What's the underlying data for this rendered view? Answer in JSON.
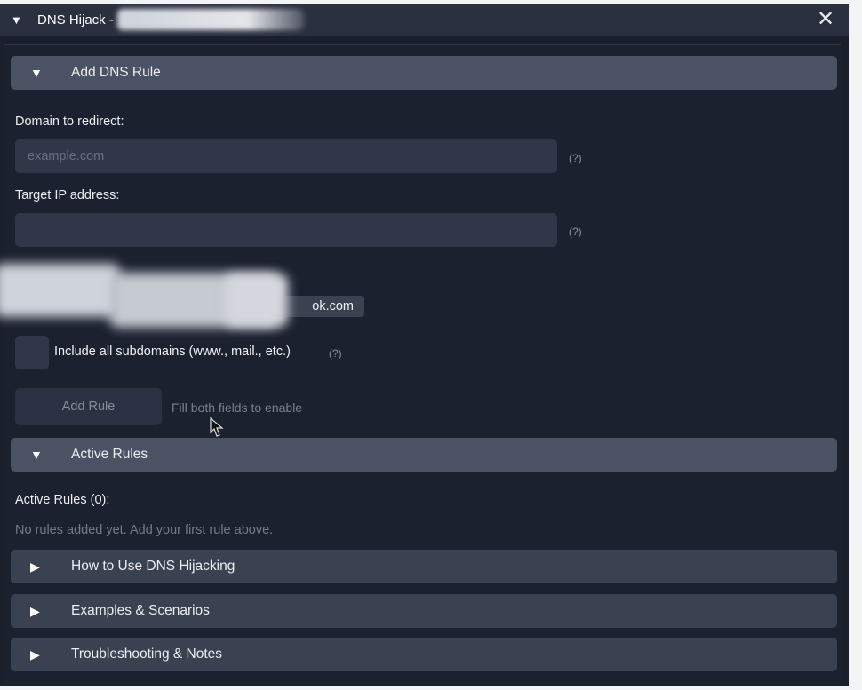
{
  "window": {
    "title": "DNS Hijack -",
    "title_arrow": "▼",
    "close_glyph": "✕"
  },
  "sections": {
    "add_rule": {
      "arrow": "▼",
      "label": "Add DNS Rule"
    },
    "active_rules": {
      "arrow": "▼",
      "label": "Active Rules"
    },
    "how_to": {
      "arrow": "▶",
      "label": "How to Use DNS Hijacking"
    },
    "examples": {
      "arrow": "▶",
      "label": "Examples & Scenarios"
    },
    "troubleshooting": {
      "arrow": "▶",
      "label": "Troubleshooting & Notes"
    }
  },
  "form": {
    "domain_label": "Domain to redirect:",
    "domain_placeholder": "example.com",
    "domain_value": "",
    "domain_help": "(?)",
    "ip_label": "Target IP address:",
    "ip_placeholder": "",
    "ip_value": "",
    "ip_help": "(?)",
    "quick_pick_text": "ok.com",
    "subdomains_label": "Include all subdomains (www., mail., etc.)",
    "subdomains_help": "(?)",
    "subdomains_checked": false,
    "add_button_label": "Add Rule",
    "add_button_hint": "Fill both fields to enable"
  },
  "active_rules": {
    "title": "Active Rules (0):",
    "count": 0,
    "empty_message": "No rules added yet. Add your first rule above."
  },
  "colors": {
    "window_bg": "#1b1f2b",
    "titlebar_bg": "#2a3040",
    "header_expanded": "#4a5263",
    "header_collapsed": "#3a4252",
    "input_bg": "#303749"
  }
}
